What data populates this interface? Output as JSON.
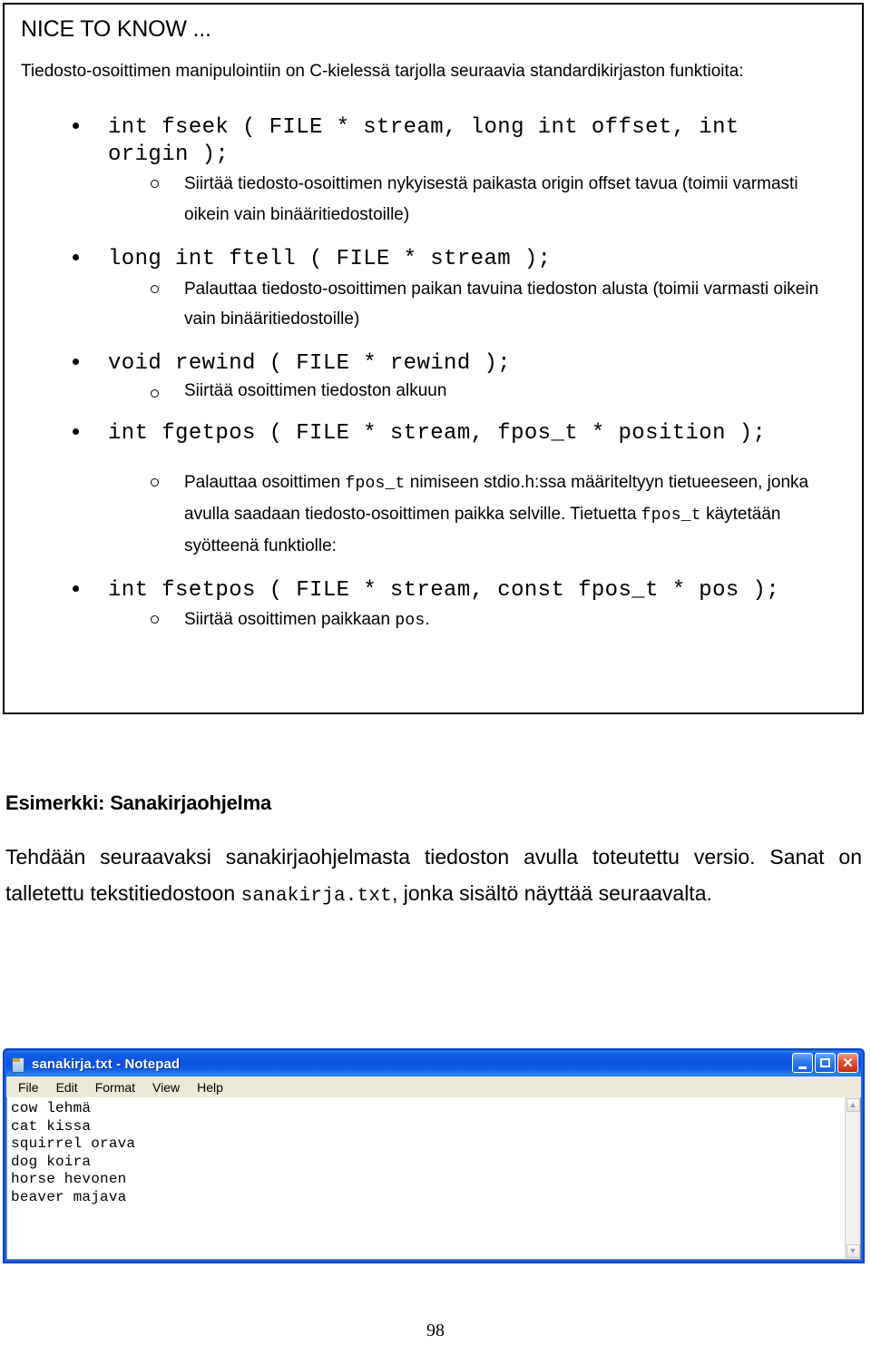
{
  "callout": {
    "heading": "NICE TO KNOW ...",
    "intro": "Tiedosto-osoittimen manipulointiin on C-kielessä tarjolla seuraavia standardikirjaston funktioita:",
    "items": [
      {
        "code": "int fseek ( FILE * stream, long int offset, int\norigin );",
        "note": "Siirtää tiedosto-osoittimen nykyisestä paikasta origin offset tavua (toimii varmasti oikein vain binääritiedostoille)"
      },
      {
        "code": "long int ftell ( FILE * stream );",
        "note": "Palauttaa tiedosto-osoittimen paikan tavuina tiedoston alusta (toimii varmasti oikein vain binääritiedostoille)"
      },
      {
        "code": "void rewind ( FILE * rewind );",
        "note": "Siirtää osoittimen tiedoston alkuun"
      },
      {
        "code": "int fgetpos ( FILE * stream, fpos_t * position );",
        "note_parts": [
          {
            "text": "Palauttaa osoittimen ",
            "mono": false
          },
          {
            "text": "fpos_t",
            "mono": true
          },
          {
            "text": " nimiseen stdio.h:ssa määriteltyyn tietueeseen, jonka avulla saadaan tiedosto-osoittimen paikka selville. Tietuetta ",
            "mono": false
          },
          {
            "text": "fpos_t",
            "mono": true
          },
          {
            "text": " käytetään syötteenä funktiolle:",
            "mono": false
          }
        ]
      },
      {
        "code": "int fsetpos ( FILE * stream, const fpos_t * pos );",
        "note_parts": [
          {
            "text": "Siirtää osoittimen paikkaan ",
            "mono": false
          },
          {
            "text": "pos",
            "mono": true
          },
          {
            "text": ".",
            "mono": false
          }
        ]
      }
    ]
  },
  "section": {
    "title": "Esimerkki: Sanakirjaohjelma",
    "body_parts": [
      {
        "text": "Tehdään seuraavaksi sanakirjaohjelmasta tiedoston avulla toteutettu versio. Sanat on talletettu tekstitiedostoon ",
        "mono": false
      },
      {
        "text": "sanakirja.txt",
        "mono": true
      },
      {
        "text": ", jonka sisältö näyttää seuraavalta.",
        "mono": false
      }
    ]
  },
  "notepad": {
    "title": "sanakirja.txt - Notepad",
    "menus": [
      "File",
      "Edit",
      "Format",
      "View",
      "Help"
    ],
    "content": "cow lehmä\ncat kissa\nsquirrel orava\ndog koira\nhorse hevonen\nbeaver majava",
    "buttons": {
      "minimize": "minimize",
      "maximize": "maximize",
      "close": "close"
    },
    "scroll_up": "▲",
    "scroll_down": "▼"
  },
  "footer": {
    "page_number": "98"
  },
  "colors": {
    "titlebar_blue": "#0a52df",
    "close_red": "#c02c12",
    "menubar": "#ece9d8"
  }
}
